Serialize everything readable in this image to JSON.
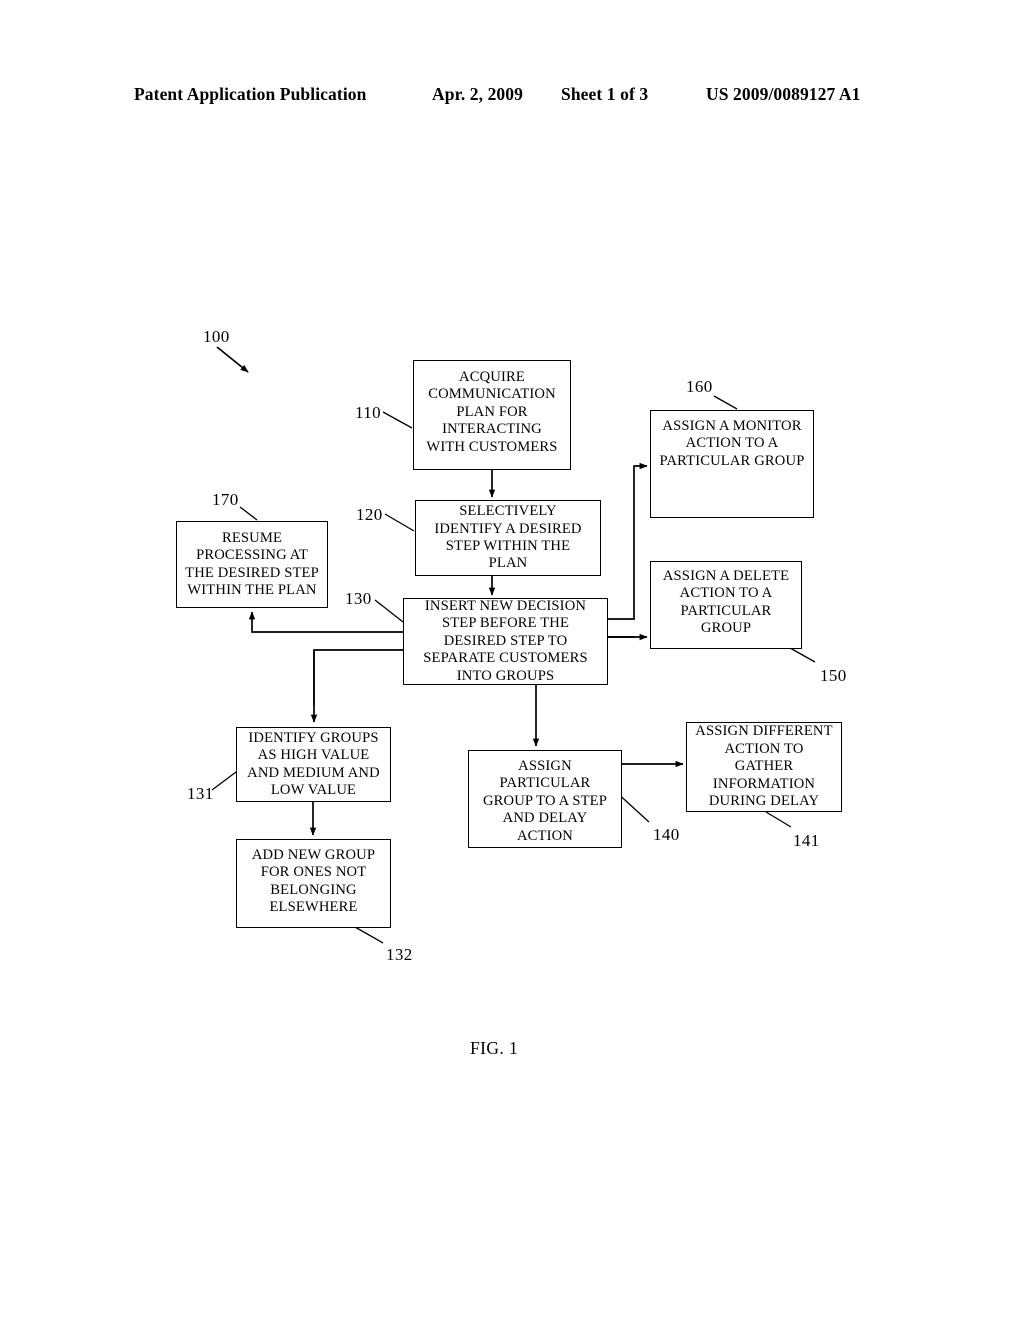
{
  "header": {
    "publication": "Patent Application Publication",
    "date": "Apr. 2, 2009",
    "sheet": "Sheet 1 of 3",
    "patent_number": "US 2009/0089127 A1"
  },
  "figure": {
    "caption": "FIG. 1",
    "diagram_reference": "100",
    "nodes": [
      {
        "ref": "110",
        "text": "ACQUIRE\nCOMMUNICATION\nPLAN FOR\nINTERACTING\nWITH CUSTOMERS"
      },
      {
        "ref": "120",
        "text": "SELECTIVELY\nIDENTIFY A DESIRED\nSTEP WITHIN THE\nPLAN"
      },
      {
        "ref": "130",
        "text": "INSERT NEW DECISION\nSTEP BEFORE THE\nDESIRED STEP TO\nSEPARATE CUSTOMERS\nINTO GROUPS"
      },
      {
        "ref": "131",
        "text": "IDENTIFY GROUPS\nAS HIGH VALUE\nAND MEDIUM AND\nLOW VALUE"
      },
      {
        "ref": "132",
        "text": "ADD NEW GROUP\nFOR ONES NOT\nBELONGING\nELSEWHERE"
      },
      {
        "ref": "140",
        "text": "ASSIGN\nPARTICULAR\nGROUP TO A STEP\nAND DELAY\nACTION"
      },
      {
        "ref": "141",
        "text": "ASSIGN DIFFERENT\nACTION TO\nGATHER\nINFORMATION\nDURING DELAY"
      },
      {
        "ref": "150",
        "text": "ASSIGN A DELETE\nACTION TO A\nPARTICULAR\nGROUP"
      },
      {
        "ref": "160",
        "text": "ASSIGN A MONITOR\nACTION TO A\nPARTICULAR GROUP"
      },
      {
        "ref": "170",
        "text": "RESUME\nPROCESSING AT\nTHE DESIRED STEP\nWITHIN THE PLAN"
      }
    ]
  }
}
